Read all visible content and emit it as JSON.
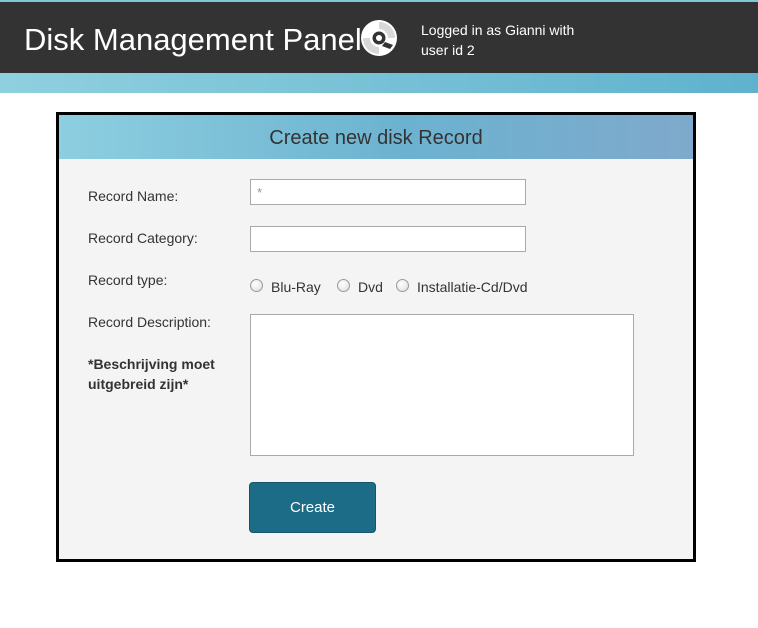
{
  "header": {
    "app_title": "Disk Management Panel",
    "icon": "disc-icon",
    "login_info": "Logged in as Gianni with user id 2"
  },
  "form": {
    "title": "Create new disk Record",
    "record_name_label": "Record Name:",
    "record_name_placeholder": "*",
    "record_name_value": "",
    "record_category_label": "Record Category:",
    "record_category_value": "",
    "record_type_label": "Record type:",
    "record_type_options": [
      "Blu-Ray",
      "Dvd",
      "Installatie-Cd/Dvd"
    ],
    "record_type_selected": null,
    "record_description_label": "Record Description:",
    "description_note": "*Beschrijving moet uitgebreid zijn*",
    "record_description_value": "",
    "submit_label": "Create"
  },
  "colors": {
    "topbar": "#333333",
    "accent": "#7fc8d8",
    "button": "#1c6b87",
    "panel_bg": "#f4f4f4"
  }
}
